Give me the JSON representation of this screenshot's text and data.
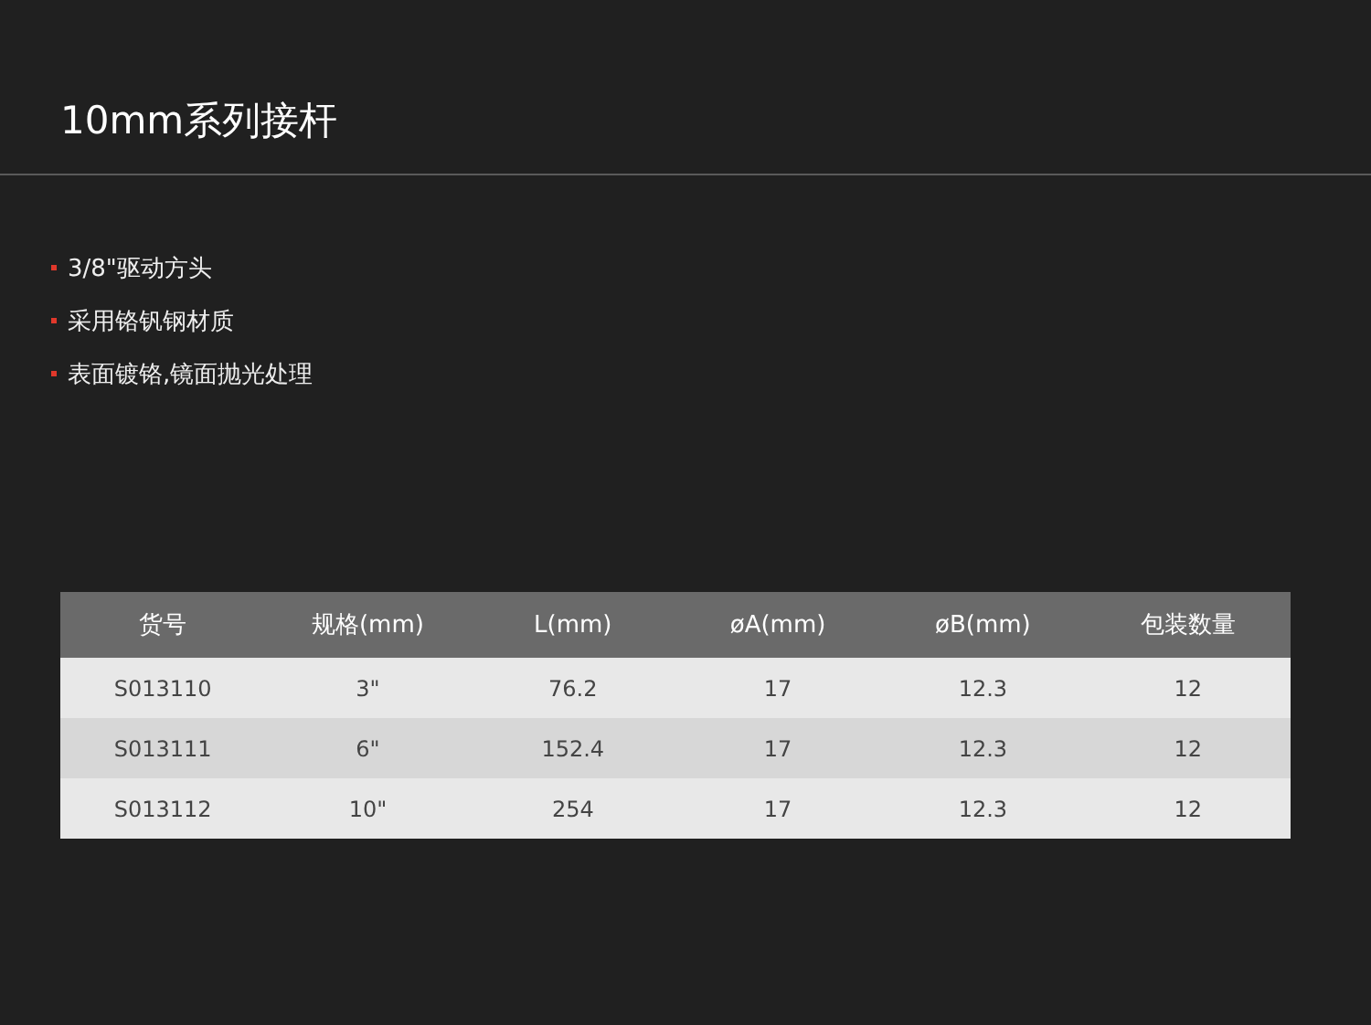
{
  "title": "10mm系列接杆",
  "features": [
    "3/8\"驱动方头",
    "采用铬钒钢材质",
    "表面镀铬,镜面抛光处理"
  ],
  "table": {
    "columns": [
      "货号",
      "规格(mm)",
      "L(mm)",
      "øA(mm)",
      "øB(mm)",
      "包装数量"
    ],
    "rows": [
      [
        "S013110",
        "3\"",
        "76.2",
        "17",
        "12.3",
        "12"
      ],
      [
        "S013111",
        "6\"",
        "152.4",
        "17",
        "12.3",
        "12"
      ],
      [
        "S013112",
        "10\"",
        "254",
        "17",
        "12.3",
        "12"
      ]
    ]
  }
}
